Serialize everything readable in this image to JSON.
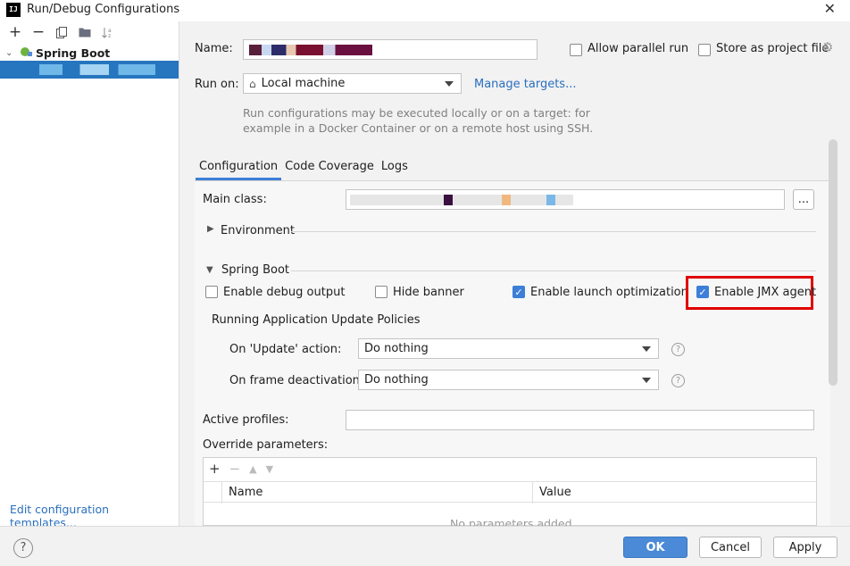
{
  "window": {
    "title": "Run/Debug Configurations",
    "app_icon_text": "IJ"
  },
  "left": {
    "toolbar": [
      "plus-icon",
      "minus-icon",
      "copy-icon",
      "folder-icon",
      "sort-icon"
    ],
    "tree": {
      "group_label": "Spring Boot",
      "selected_label": ""
    },
    "edit_templates": "Edit configuration templates..."
  },
  "form": {
    "name_label": "Name:",
    "name_value": "",
    "allow_parallel": "Allow parallel run",
    "store_project": "Store as project file",
    "run_on_label": "Run on:",
    "run_on_value": "Local machine",
    "manage_targets": "Manage targets...",
    "run_info_line1": "Run configurations may be executed locally or on a target: for",
    "run_info_line2": "example in a Docker Container or on a remote host using SSH.",
    "tabs": [
      "Configuration",
      "Code Coverage",
      "Logs"
    ],
    "main_class_label": "Main class:",
    "main_class_value": "",
    "browse": "...",
    "environment": "Environment",
    "spring_boot": "Spring Boot",
    "enable_debug": "Enable debug output",
    "hide_banner": "Hide banner",
    "enable_launch": "Enable launch optimization",
    "enable_jmx": "Enable JMX agent",
    "update_policies": "Running Application Update Policies",
    "on_update_label": "On 'Update' action:",
    "on_update_value": "Do nothing",
    "on_frame_label": "On frame deactivation:",
    "on_frame_value": "Do nothing",
    "active_profiles": "Active profiles:",
    "override_params": "Override parameters:",
    "col_name": "Name",
    "col_value": "Value",
    "no_params": "No parameters added"
  },
  "buttons": {
    "ok": "OK",
    "cancel": "Cancel",
    "apply": "Apply",
    "help": "?"
  },
  "colors": {
    "accent": "#3d7fd8",
    "selection": "#2675bf",
    "highlight": "#e00000"
  }
}
